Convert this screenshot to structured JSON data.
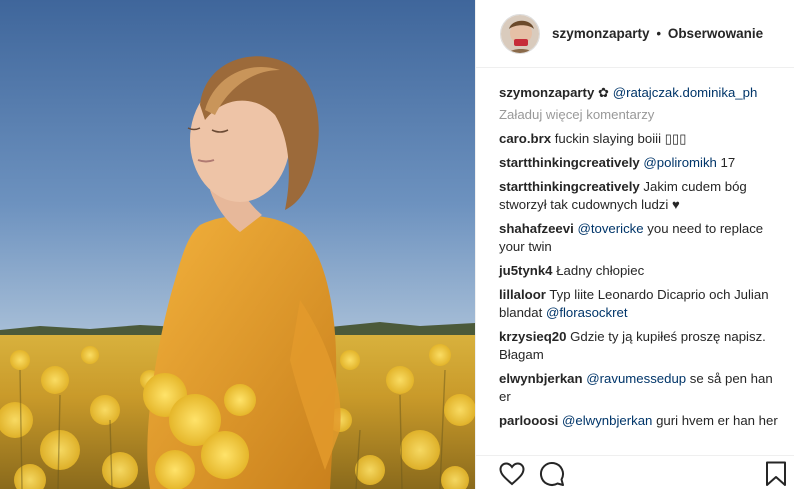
{
  "header": {
    "username": "szymonzaparty",
    "separator": "•",
    "follow_status": "Obserwowanie"
  },
  "caption": {
    "username": "szymonzaparty",
    "flower": "✿",
    "mention": "@ratajczak.dominika_ph"
  },
  "load_more": "Załaduj więcej komentarzy",
  "comments": [
    {
      "user": "caro.brx",
      "text": "fuckin slaying boiii",
      "emoji": "▯▯▯"
    },
    {
      "user": "startthinkingcreatively",
      "mention": "@poliromikh",
      "text": "17"
    },
    {
      "user": "startthinkingcreatively",
      "text": "Jakim cudem bóg stworzył tak cudownych ludzi",
      "emoji": "♥"
    },
    {
      "user": "shahafzeevi",
      "mention": "@tovericke",
      "text": "you need to replace your twin"
    },
    {
      "user": "ju5tynk4",
      "text": "Ładny chłopiec"
    },
    {
      "user": "lillaloor",
      "text": "Typ liite Leonardo Dicaprio och Julian blandat",
      "mention": "@florasockret"
    },
    {
      "user": "krzysieq20",
      "text": "Gdzie ty ją kupiłeś proszę napisz. Błagam"
    },
    {
      "user": "elwynbjerkan",
      "mention": "@ravumessedup",
      "text": "se så pen han er"
    },
    {
      "user": "parlooosi",
      "mention": "@elwynbjerkan",
      "text": "guri hvem er han her"
    }
  ],
  "icons": {
    "like": "heart-outline-icon",
    "comment": "speech-bubble-icon",
    "save": "bookmark-icon"
  },
  "colors": {
    "link": "#003569",
    "muted": "#999999",
    "text": "#262626",
    "sky": "#4f76a6",
    "field": "#e2b43a",
    "shirt": "#eaa02d"
  }
}
